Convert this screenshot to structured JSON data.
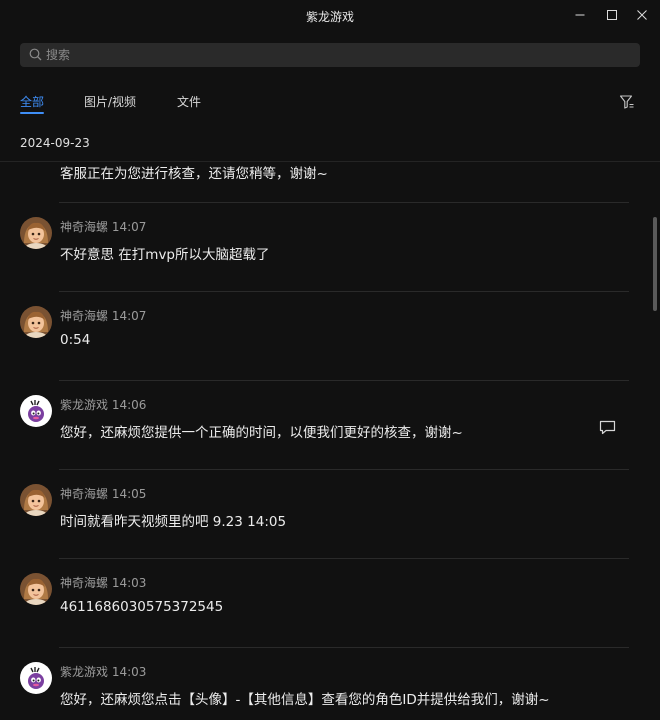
{
  "window": {
    "title": "紫龙游戏"
  },
  "search": {
    "placeholder": "搜索"
  },
  "tabs": [
    {
      "label": "全部",
      "active": true
    },
    {
      "label": "图片/视频",
      "active": false
    },
    {
      "label": "文件",
      "active": false
    }
  ],
  "date_header": "2024-09-23",
  "messages": [
    {
      "text": "客服正在为您进行核查，还请您稍等，谢谢~"
    },
    {
      "sender": "神奇海螺",
      "time": "14:07",
      "text": "不好意思 在打mvp所以大脑超载了"
    },
    {
      "sender": "神奇海螺",
      "time": "14:07",
      "text": "0:54"
    },
    {
      "sender": "紫龙游戏",
      "time": "14:06",
      "text": "您好，还麻烦您提供一个正确的时间，以便我们更好的核查，谢谢~"
    },
    {
      "sender": "神奇海螺",
      "time": "14:05",
      "text": "时间就看昨天视频里的吧 9.23 14:05"
    },
    {
      "sender": "神奇海螺",
      "time": "14:03",
      "text": "4611686030575372545"
    },
    {
      "sender": "紫龙游戏",
      "time": "14:03",
      "text": "您好，还麻烦您点击【头像】-【其他信息】查看您的角色ID并提供给我们，谢谢~"
    }
  ],
  "colors": {
    "accent": "#3f8ef6",
    "background": "#111111",
    "search_bg": "#2a2a2a"
  }
}
